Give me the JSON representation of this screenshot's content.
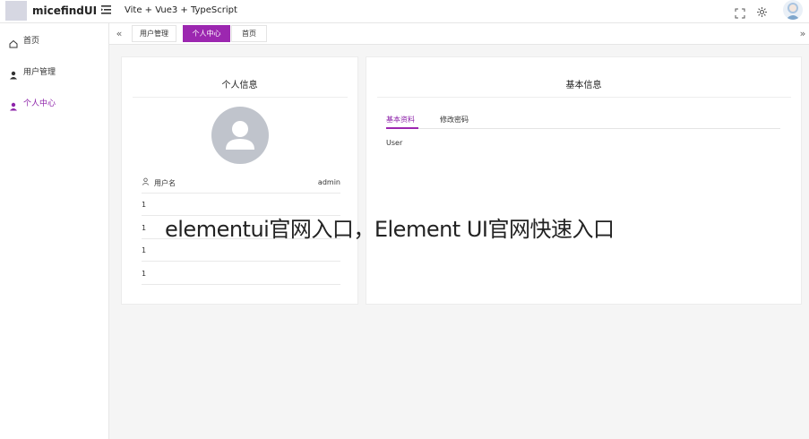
{
  "header": {
    "app_title": "micefindUI",
    "subtitle": "Vite + Vue3 + TypeScript"
  },
  "sidebar": {
    "items": [
      {
        "label": "首页",
        "icon": "home-icon"
      },
      {
        "label": "用户管理",
        "icon": "user-icon"
      },
      {
        "label": "个人中心",
        "icon": "user-icon",
        "active": true
      }
    ]
  },
  "tabs": [
    {
      "label": "用户管理"
    },
    {
      "label": "个人中心",
      "active": true
    },
    {
      "label": "首页"
    }
  ],
  "profile_card": {
    "title": "个人信息",
    "rows": [
      {
        "key": "用户名",
        "value": "admin"
      },
      {
        "key": "1",
        "value": ""
      },
      {
        "key": "1",
        "value": ""
      },
      {
        "key": "1",
        "value": ""
      },
      {
        "key": "1",
        "value": ""
      }
    ]
  },
  "basic_card": {
    "title": "基本信息",
    "tabs": [
      "基本资料",
      "修改密码"
    ],
    "active_tab": 0,
    "pane_text": "User"
  },
  "watermark": "elementui官网入口，Element UI官网快速入口",
  "colors": {
    "accent": "#9c27b0",
    "avatar_bg": "#c0c4cc"
  }
}
